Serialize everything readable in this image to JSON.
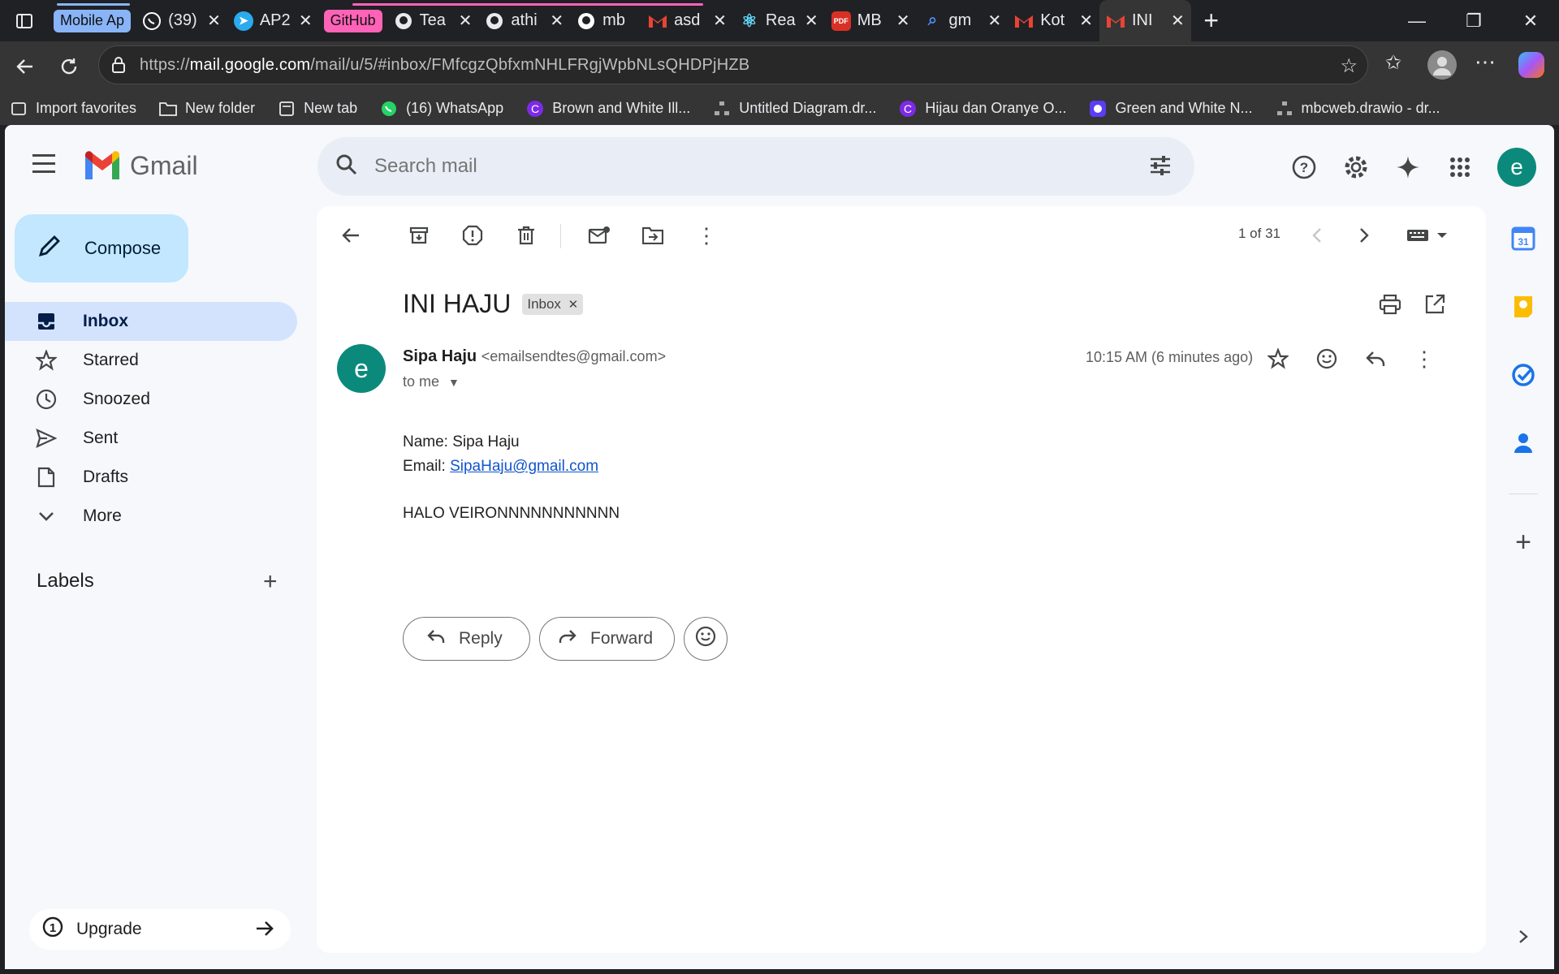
{
  "browser": {
    "tabs": [
      {
        "title": "Mobile Ap",
        "group_label": "Mobile Ap"
      },
      {
        "title": "(39)",
        "icon": "whatsapp-icon"
      },
      {
        "title": "AP2",
        "icon": "telegram-icon"
      },
      {
        "title": "GitHub",
        "group_label": "GitHub"
      },
      {
        "title": "Tea",
        "icon": "github-icon"
      },
      {
        "title": "athi",
        "icon": "github-icon"
      },
      {
        "title": "mb",
        "icon": "github-icon"
      },
      {
        "title": "asd",
        "icon": "gmail-icon"
      },
      {
        "title": "Rea",
        "icon": "react-icon"
      },
      {
        "title": "MB",
        "icon": "pdf-icon"
      },
      {
        "title": "gm",
        "icon": "search-icon"
      },
      {
        "title": "Kot",
        "icon": "gmail-icon"
      },
      {
        "title": "INI",
        "icon": "gmail-icon"
      }
    ],
    "url_prefix": "https://",
    "url_host": "mail.google.com",
    "url_path": "/mail/u/5/#inbox/FMfcgzQbfxmNHLFRgjWpbNLsQHDPjHZB",
    "bookmarks": [
      {
        "label": "Import favorites",
        "icon": "import-icon"
      },
      {
        "label": "New folder",
        "icon": "folder-icon"
      },
      {
        "label": "New tab",
        "icon": "newtab-icon"
      },
      {
        "label": "(16) WhatsApp",
        "icon": "whatsapp-icon"
      },
      {
        "label": "Brown and White Ill...",
        "icon": "canva-icon"
      },
      {
        "label": "Untitled Diagram.dr...",
        "icon": "drawio-icon"
      },
      {
        "label": "Hijau dan Oranye O...",
        "icon": "canva-icon"
      },
      {
        "label": "Green and White N...",
        "icon": "canva-icon"
      },
      {
        "label": "mbcweb.drawio - dr...",
        "icon": "drawio-icon"
      }
    ]
  },
  "gmail": {
    "logo_text": "Gmail",
    "search_placeholder": "Search mail",
    "avatar_letter": "e",
    "compose_label": "Compose",
    "nav": [
      {
        "label": "Inbox",
        "icon": "inbox-icon",
        "active": true
      },
      {
        "label": "Starred",
        "icon": "star-icon"
      },
      {
        "label": "Snoozed",
        "icon": "clock-icon"
      },
      {
        "label": "Sent",
        "icon": "send-icon"
      },
      {
        "label": "Drafts",
        "icon": "draft-icon"
      },
      {
        "label": "More",
        "icon": "chevron-down-icon"
      }
    ],
    "labels_heading": "Labels",
    "upgrade_label": "Upgrade",
    "pager": "1 of 31",
    "email": {
      "subject": "INI HAJU",
      "label_chip": "Inbox",
      "sender_initial": "e",
      "sender_name": "Sipa Haju",
      "sender_email": "<emailsendtes@gmail.com>",
      "to": "to me",
      "time": "10:15 AM (6 minutes ago)",
      "body_name": "Name: Sipa Haju",
      "body_email_label": "Email: ",
      "body_email_link": "SipaHaju@gmail.com",
      "body_message": "HALO VEIRONNNNNNNNNNN"
    },
    "reply_label": "Reply",
    "forward_label": "Forward"
  }
}
